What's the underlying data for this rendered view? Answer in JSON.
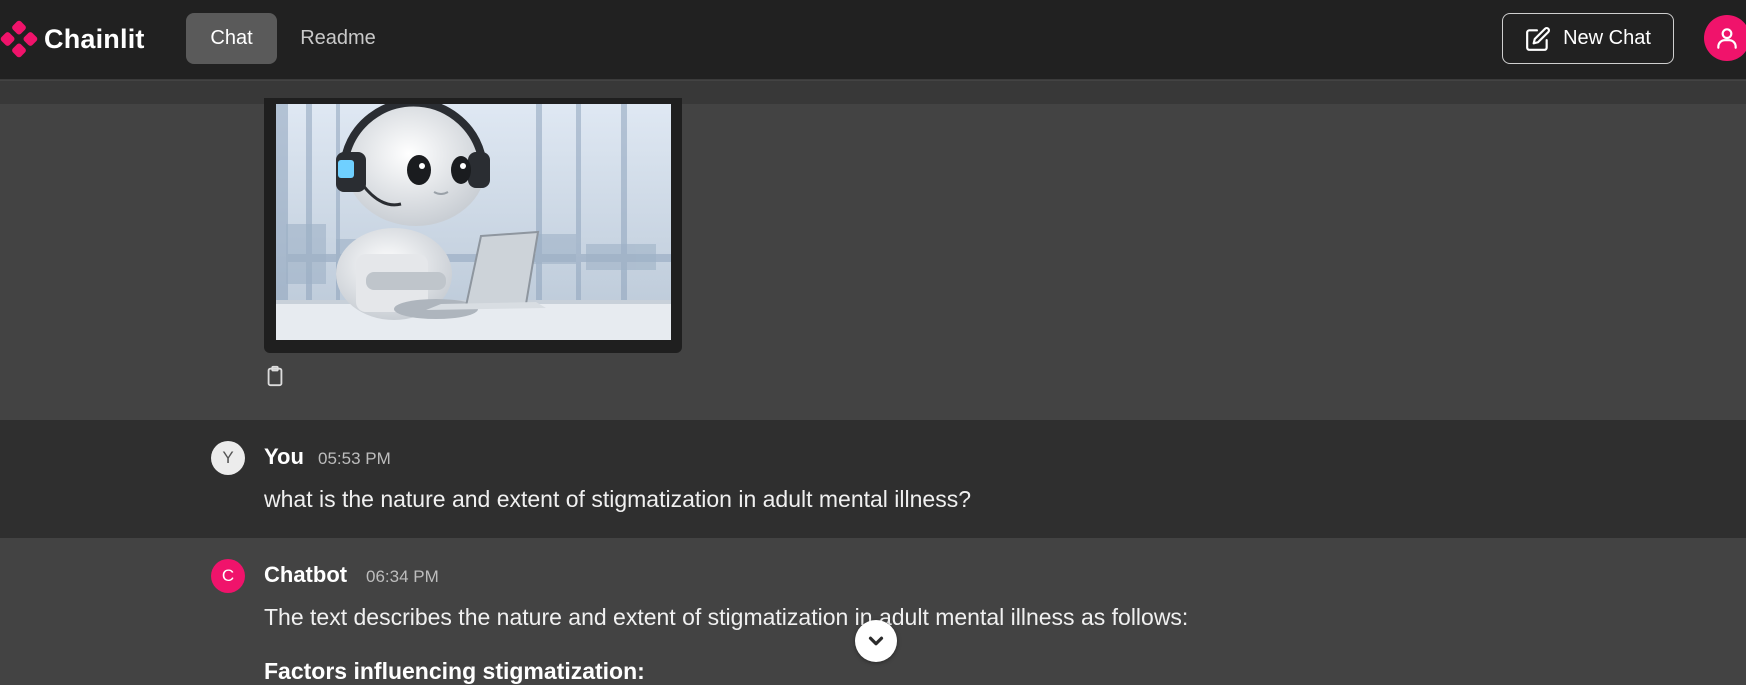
{
  "app": {
    "name": "Chainlit",
    "brand_color": "#f0136b"
  },
  "nav": {
    "tabs": [
      {
        "label": "Chat",
        "active": true
      },
      {
        "label": "Readme",
        "active": false
      }
    ]
  },
  "header": {
    "new_chat_label": "New Chat",
    "new_chat_icon": "edit-icon",
    "user_icon": "user-icon"
  },
  "image_message": {
    "image_alt": "robot-with-headset-and-laptop",
    "copy_icon": "clipboard-icon"
  },
  "messages": [
    {
      "avatar": "Y",
      "author": "You",
      "time": "05:53 PM",
      "text": "what is the nature and extent of stigmatization in adult mental illness?"
    },
    {
      "avatar": "C",
      "author": "Chatbot",
      "time": "06:34 PM",
      "text": "The text describes the nature and extent of stigmatization in adult mental illness as follows:",
      "heading": "Factors influencing stigmatization:"
    }
  ],
  "scroll_button": {
    "icon": "chevron-down-icon"
  }
}
